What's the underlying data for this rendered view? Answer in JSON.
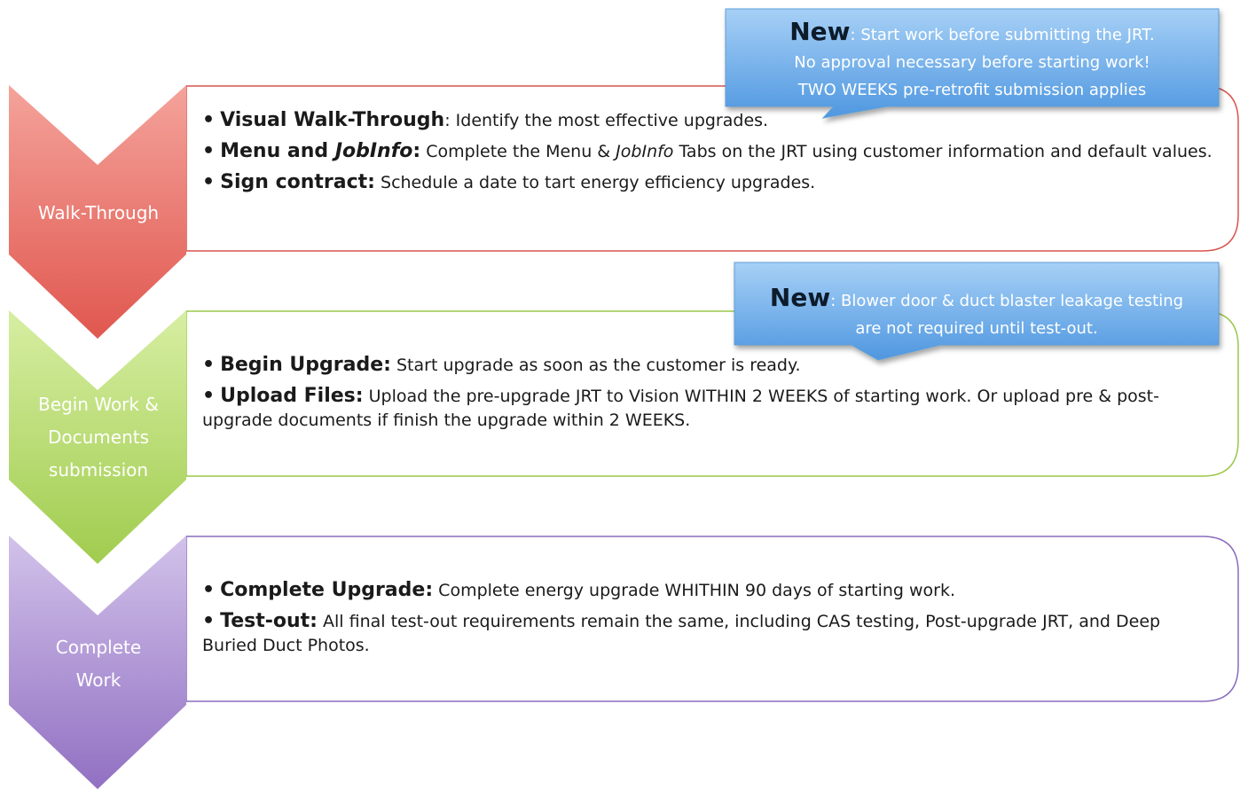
{
  "colors": {
    "stage1": "#e0605a",
    "stage1_light": "#f4a39b",
    "stage2": "#a8d05a",
    "stage2_light": "#d4ec9e",
    "stage3": "#9a78c8",
    "stage3_light": "#cdbbe6",
    "callout": "#5aa2e6",
    "callout_light": "#9ccaf4"
  },
  "stages": [
    {
      "label": [
        "Walk-Through"
      ],
      "bullets": [
        {
          "head": "Visual Walk-Through",
          "head_italic": "",
          "colon": ":",
          "text": " Identify the most effective upgrades."
        },
        {
          "head": "Menu and ",
          "head_italic": "JobInfo",
          "colon": ":",
          "text_pre": " Complete the Menu & ",
          "text_italic": "JobInfo",
          "text_post": " Tabs on the JRT using customer information and default values."
        },
        {
          "head": "Sign contract",
          "head_italic": "",
          "colon": ":",
          "text": " Schedule a date to tart energy efficiency upgrades."
        }
      ],
      "callout": {
        "new": "New",
        "lines": [
          ": Start work before submitting the JRT.",
          "No approval necessary before starting work!",
          "TWO WEEKS pre-retrofit submission applies"
        ]
      }
    },
    {
      "label": [
        "Begin Work &",
        "Documents",
        "submission"
      ],
      "bullets": [
        {
          "head": "Begin Upgrade",
          "colon": ":",
          "text": " Start upgrade as soon as the customer is ready."
        },
        {
          "head": "Upload Files",
          "colon": ":",
          "text": " Upload the pre-upgrade JRT to Vision WITHIN 2 WEEKS of starting  work. Or upload pre & post-upgrade documents if finish the upgrade within 2 WEEKS."
        }
      ],
      "callout": {
        "new": "New",
        "lines": [
          ": Blower door & duct blaster leakage testing",
          "are not required until test-out."
        ]
      }
    },
    {
      "label": [
        "Complete",
        "Work"
      ],
      "bullets": [
        {
          "head": "Complete Upgrade",
          "colon": ":",
          "text": " Complete energy upgrade WHITHIN 90 days of starting work."
        },
        {
          "head": "Test-out",
          "colon": ":",
          "text": " All final test-out requirements remain the same, including CAS testing, Post-upgrade JRT, and Deep Buried Duct Photos."
        }
      ]
    }
  ]
}
